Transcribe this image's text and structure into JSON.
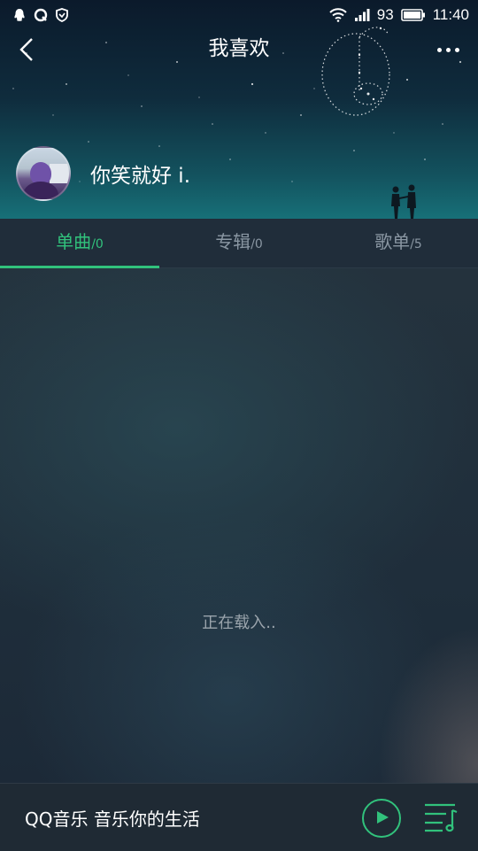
{
  "status_bar": {
    "battery_level": "93",
    "time": "11:40",
    "left_icons": [
      "qq-icon",
      "qzone-icon",
      "shield-icon"
    ],
    "right_icons": [
      "wifi-icon",
      "signal-icon",
      "battery-icon"
    ]
  },
  "header": {
    "title": "我喜欢",
    "back_icon": "chevron-left-icon",
    "more_icon": "more-dots-icon"
  },
  "profile": {
    "user_name": "你笑就好 i."
  },
  "tabs": [
    {
      "label": "单曲",
      "count": "/0",
      "active": true
    },
    {
      "label": "专辑",
      "count": "/0",
      "active": false
    },
    {
      "label": "歌单",
      "count": "/5",
      "active": false
    }
  ],
  "content": {
    "loading_text": "正在载入.."
  },
  "player": {
    "slogan": "QQ音乐 音乐你的生活",
    "play_icon": "play-icon",
    "playlist_icon": "playlist-icon"
  },
  "colors": {
    "accent": "#31c27c",
    "tab_inactive": "#8a97a3",
    "tab_bar_bg": "#202d3a",
    "player_bg": "#1f2a34"
  }
}
